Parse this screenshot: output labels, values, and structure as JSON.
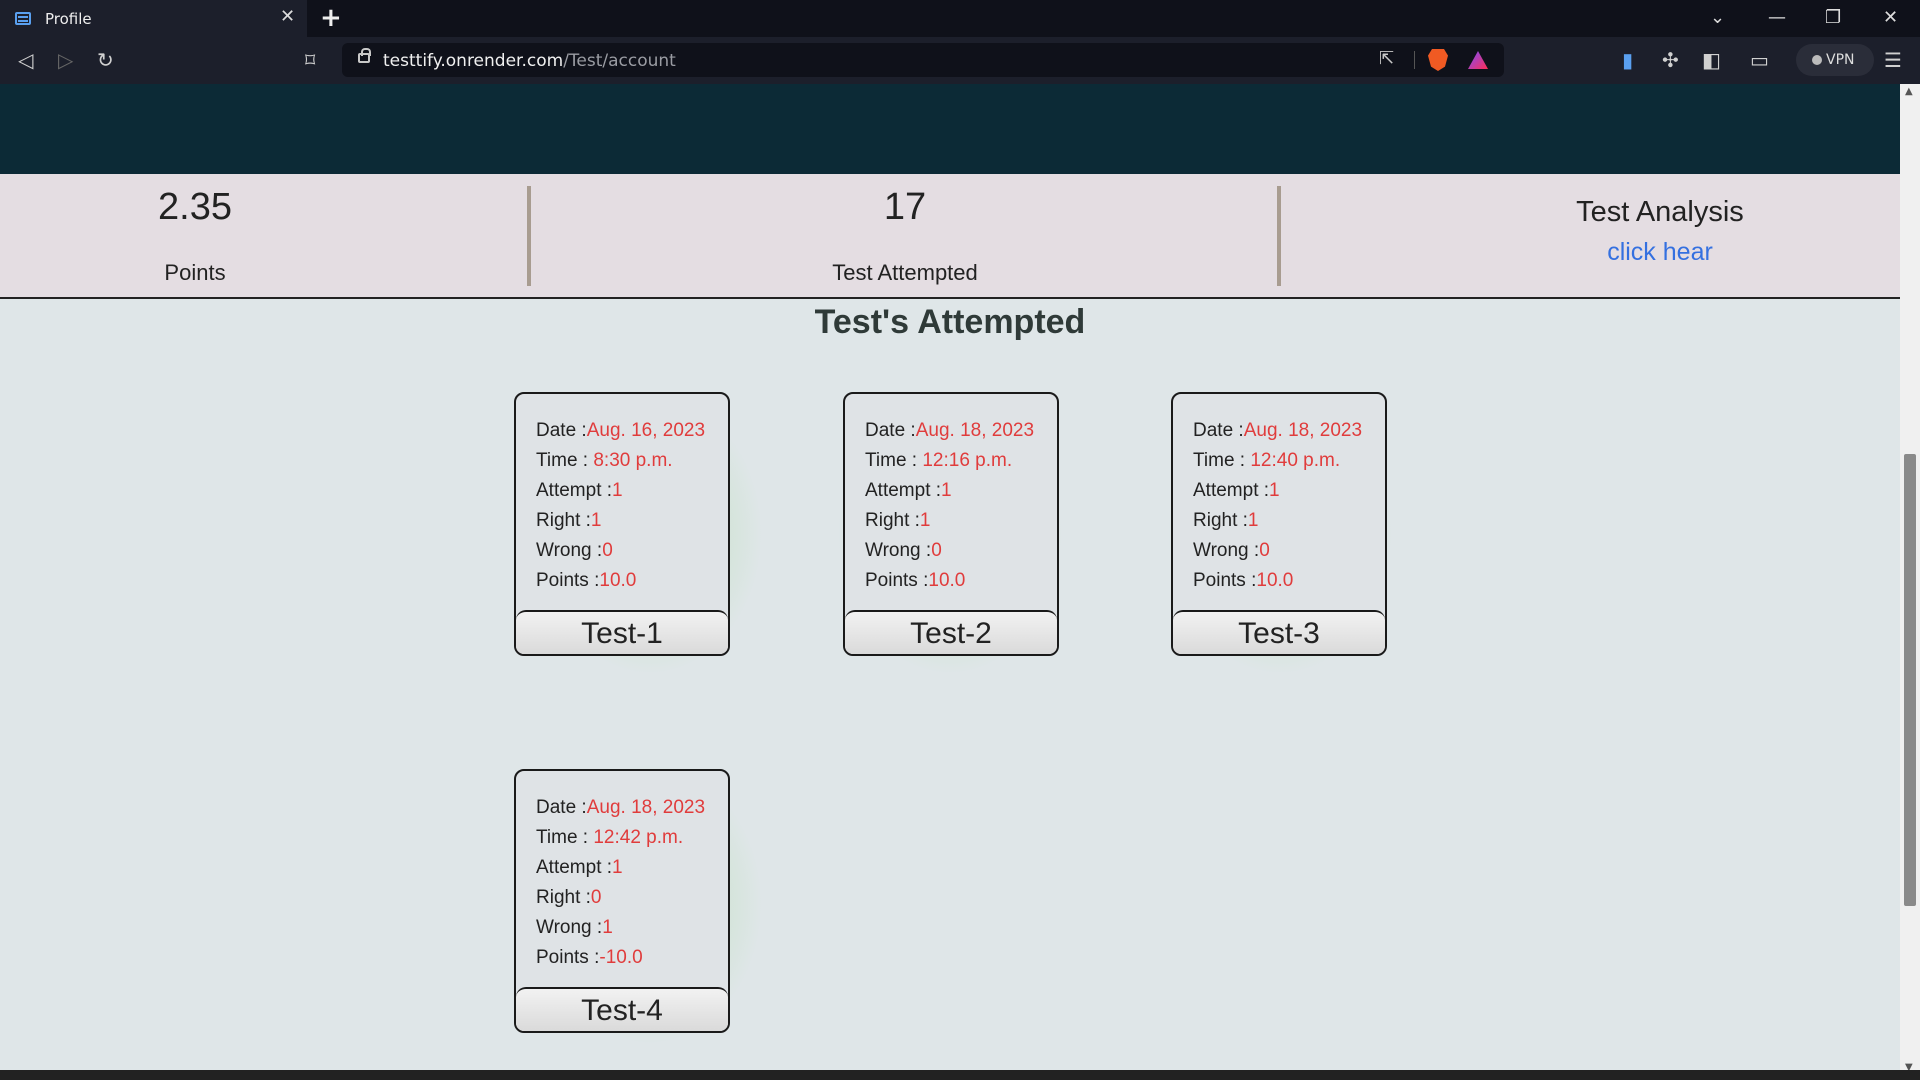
{
  "browser": {
    "tab_title": "Profile",
    "tab_close": "✕",
    "new_tab": "+",
    "url_host": "testtify.onrender.com",
    "url_path": "/Test/account",
    "vpn_label": "VPN",
    "window_controls": {
      "minimize": "—",
      "maximize": "❐",
      "close": "✕",
      "tab_list": "⌄"
    }
  },
  "stats": {
    "points_value": "2.35",
    "points_label": "Points",
    "attempted_value": "17",
    "attempted_label": "Test Attempted",
    "analysis_title": "Test Analysis",
    "analysis_link": "click hear"
  },
  "section_title": "Test's Attempted",
  "field_labels": {
    "date": "Date :",
    "time": "Time : ",
    "attempt": "Attempt :",
    "right": "Right :",
    "wrong": "Wrong :",
    "points": "Points :"
  },
  "tests": [
    {
      "name": "Test-1",
      "date": "Aug. 16, 2023",
      "time": "8:30 p.m.",
      "attempt": "1",
      "right": "1",
      "wrong": "0",
      "points": "10.0"
    },
    {
      "name": "Test-2",
      "date": "Aug. 18, 2023",
      "time": "12:16 p.m.",
      "attempt": "1",
      "right": "1",
      "wrong": "0",
      "points": "10.0"
    },
    {
      "name": "Test-3",
      "date": "Aug. 18, 2023",
      "time": "12:40 p.m.",
      "attempt": "1",
      "right": "1",
      "wrong": "0",
      "points": "10.0"
    },
    {
      "name": "Test-4",
      "date": "Aug. 18, 2023",
      "time": "12:42 p.m.",
      "attempt": "1",
      "right": "0",
      "wrong": "1",
      "points": "-10.0"
    }
  ],
  "colors": {
    "hero": "#0c2a36",
    "stats_bg": "#e4dde2",
    "value_red": "#e03c3c",
    "link_blue": "#3470e0"
  }
}
